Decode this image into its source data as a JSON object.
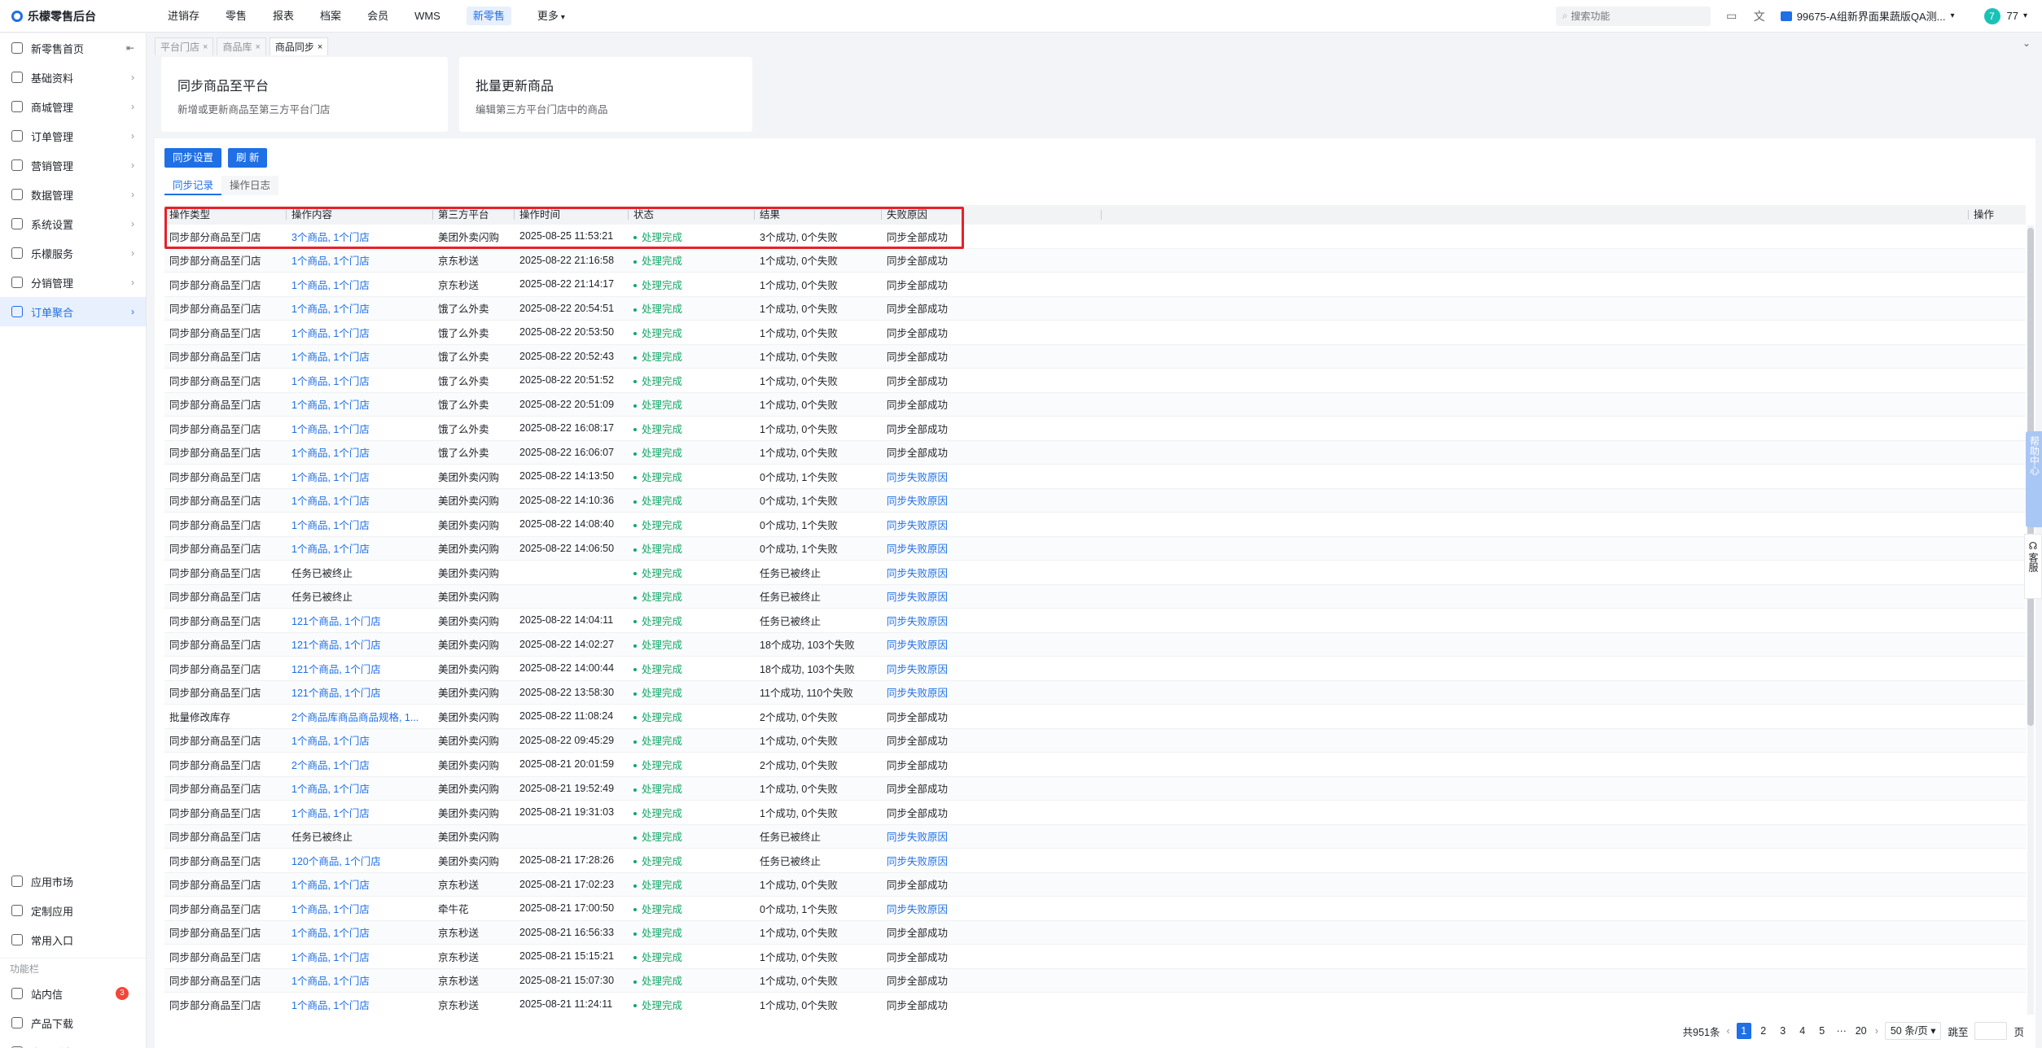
{
  "app": {
    "title": "乐檬零售后台"
  },
  "topnav": [
    {
      "label": "进销存",
      "active": false
    },
    {
      "label": "零售",
      "active": false
    },
    {
      "label": "报表",
      "active": false
    },
    {
      "label": "档案",
      "active": false
    },
    {
      "label": "会员",
      "active": false
    },
    {
      "label": "WMS",
      "active": false
    },
    {
      "label": "新零售",
      "active": true
    },
    {
      "label": "更多",
      "active": false
    }
  ],
  "search": {
    "placeholder": "搜索功能"
  },
  "store": {
    "name": "99675-A组新界面果蔬版QA测..."
  },
  "user": {
    "avatar": "7",
    "name": "77"
  },
  "sidebar": {
    "items": [
      {
        "label": "新零售首页"
      },
      {
        "label": "基础资料"
      },
      {
        "label": "商城管理"
      },
      {
        "label": "订单管理"
      },
      {
        "label": "营销管理"
      },
      {
        "label": "数据管理"
      },
      {
        "label": "系统设置"
      },
      {
        "label": "乐檬服务"
      },
      {
        "label": "分销管理"
      },
      {
        "label": "订单聚合"
      }
    ],
    "bottom": [
      {
        "label": "应用市场"
      },
      {
        "label": "定制应用"
      },
      {
        "label": "常用入口"
      }
    ],
    "section_title": "功能栏",
    "tools": [
      {
        "label": "站内信",
        "badge": "3"
      },
      {
        "label": "产品下载"
      },
      {
        "label": "文件列表"
      }
    ]
  },
  "tabs": [
    {
      "label": "平台门店"
    },
    {
      "label": "商品库"
    },
    {
      "label": "商品同步"
    }
  ],
  "cards": [
    {
      "title": "同步商品至平台",
      "desc": "新增或更新商品至第三方平台门店"
    },
    {
      "title": "批量更新商品",
      "desc": "编辑第三方平台门店中的商品"
    }
  ],
  "buttons": {
    "sync_settings": "同步设置",
    "refresh": "刷 新"
  },
  "subtabs": [
    {
      "label": "同步记录"
    },
    {
      "label": "操作日志"
    }
  ],
  "table": {
    "headers": [
      "操作类型",
      "操作内容",
      "第三方平台",
      "操作时间",
      "状态",
      "结果",
      "失败原因",
      "",
      "操作"
    ],
    "rows": [
      [
        "同步部分商品至门店",
        "3个商品, 1个门店",
        "美团外卖闪购",
        "2025-08-25 11:53:21",
        "处理完成",
        "3个成功, 0个失败",
        "同步全部成功"
      ],
      [
        "同步部分商品至门店",
        "1个商品, 1个门店",
        "京东秒送",
        "2025-08-22 21:16:58",
        "处理完成",
        "1个成功, 0个失败",
        "同步全部成功"
      ],
      [
        "同步部分商品至门店",
        "1个商品, 1个门店",
        "京东秒送",
        "2025-08-22 21:14:17",
        "处理完成",
        "1个成功, 0个失败",
        "同步全部成功"
      ],
      [
        "同步部分商品至门店",
        "1个商品, 1个门店",
        "饿了么外卖",
        "2025-08-22 20:54:51",
        "处理完成",
        "1个成功, 0个失败",
        "同步全部成功"
      ],
      [
        "同步部分商品至门店",
        "1个商品, 1个门店",
        "饿了么外卖",
        "2025-08-22 20:53:50",
        "处理完成",
        "1个成功, 0个失败",
        "同步全部成功"
      ],
      [
        "同步部分商品至门店",
        "1个商品, 1个门店",
        "饿了么外卖",
        "2025-08-22 20:52:43",
        "处理完成",
        "1个成功, 0个失败",
        "同步全部成功"
      ],
      [
        "同步部分商品至门店",
        "1个商品, 1个门店",
        "饿了么外卖",
        "2025-08-22 20:51:52",
        "处理完成",
        "1个成功, 0个失败",
        "同步全部成功"
      ],
      [
        "同步部分商品至门店",
        "1个商品, 1个门店",
        "饿了么外卖",
        "2025-08-22 20:51:09",
        "处理完成",
        "1个成功, 0个失败",
        "同步全部成功"
      ],
      [
        "同步部分商品至门店",
        "1个商品, 1个门店",
        "饿了么外卖",
        "2025-08-22 16:08:17",
        "处理完成",
        "1个成功, 0个失败",
        "同步全部成功"
      ],
      [
        "同步部分商品至门店",
        "1个商品, 1个门店",
        "饿了么外卖",
        "2025-08-22 16:06:07",
        "处理完成",
        "1个成功, 0个失败",
        "同步全部成功"
      ],
      [
        "同步部分商品至门店",
        "1个商品, 1个门店",
        "美团外卖闪购",
        "2025-08-22 14:13:50",
        "处理完成",
        "0个成功, 1个失败",
        "同步失败原因"
      ],
      [
        "同步部分商品至门店",
        "1个商品, 1个门店",
        "美团外卖闪购",
        "2025-08-22 14:10:36",
        "处理完成",
        "0个成功, 1个失败",
        "同步失败原因"
      ],
      [
        "同步部分商品至门店",
        "1个商品, 1个门店",
        "美团外卖闪购",
        "2025-08-22 14:08:40",
        "处理完成",
        "0个成功, 1个失败",
        "同步失败原因"
      ],
      [
        "同步部分商品至门店",
        "1个商品, 1个门店",
        "美团外卖闪购",
        "2025-08-22 14:06:50",
        "处理完成",
        "0个成功, 1个失败",
        "同步失败原因"
      ],
      [
        "同步部分商品至门店",
        "任务已被终止",
        "美团外卖闪购",
        "",
        "处理完成",
        "任务已被终止",
        "同步失败原因"
      ],
      [
        "同步部分商品至门店",
        "任务已被终止",
        "美团外卖闪购",
        "",
        "处理完成",
        "任务已被终止",
        "同步失败原因"
      ],
      [
        "同步部分商品至门店",
        "121个商品, 1个门店",
        "美团外卖闪购",
        "2025-08-22 14:04:11",
        "处理完成",
        "任务已被终止",
        "同步失败原因"
      ],
      [
        "同步部分商品至门店",
        "121个商品, 1个门店",
        "美团外卖闪购",
        "2025-08-22 14:02:27",
        "处理完成",
        "18个成功, 103个失败",
        "同步失败原因"
      ],
      [
        "同步部分商品至门店",
        "121个商品, 1个门店",
        "美团外卖闪购",
        "2025-08-22 14:00:44",
        "处理完成",
        "18个成功, 103个失败",
        "同步失败原因"
      ],
      [
        "同步部分商品至门店",
        "121个商品, 1个门店",
        "美团外卖闪购",
        "2025-08-22 13:58:30",
        "处理完成",
        "11个成功, 110个失败",
        "同步失败原因"
      ],
      [
        "批量修改库存",
        "2个商品库商品商品规格, 1...",
        "美团外卖闪购",
        "2025-08-22 11:08:24",
        "处理完成",
        "2个成功, 0个失败",
        "同步全部成功"
      ],
      [
        "同步部分商品至门店",
        "1个商品, 1个门店",
        "美团外卖闪购",
        "2025-08-22 09:45:29",
        "处理完成",
        "1个成功, 0个失败",
        "同步全部成功"
      ],
      [
        "同步部分商品至门店",
        "2个商品, 1个门店",
        "美团外卖闪购",
        "2025-08-21 20:01:59",
        "处理完成",
        "2个成功, 0个失败",
        "同步全部成功"
      ],
      [
        "同步部分商品至门店",
        "1个商品, 1个门店",
        "美团外卖闪购",
        "2025-08-21 19:52:49",
        "处理完成",
        "1个成功, 0个失败",
        "同步全部成功"
      ],
      [
        "同步部分商品至门店",
        "1个商品, 1个门店",
        "美团外卖闪购",
        "2025-08-21 19:31:03",
        "处理完成",
        "1个成功, 0个失败",
        "同步全部成功"
      ],
      [
        "同步部分商品至门店",
        "任务已被终止",
        "美团外卖闪购",
        "",
        "处理完成",
        "任务已被终止",
        "同步失败原因"
      ],
      [
        "同步部分商品至门店",
        "120个商品, 1个门店",
        "美团外卖闪购",
        "2025-08-21 17:28:26",
        "处理完成",
        "任务已被终止",
        "同步失败原因"
      ],
      [
        "同步部分商品至门店",
        "1个商品, 1个门店",
        "京东秒送",
        "2025-08-21 17:02:23",
        "处理完成",
        "1个成功, 0个失败",
        "同步全部成功"
      ],
      [
        "同步部分商品至门店",
        "1个商品, 1个门店",
        "牵牛花",
        "2025-08-21 17:00:50",
        "处理完成",
        "0个成功, 1个失败",
        "同步失败原因"
      ],
      [
        "同步部分商品至门店",
        "1个商品, 1个门店",
        "京东秒送",
        "2025-08-21 16:56:33",
        "处理完成",
        "1个成功, 0个失败",
        "同步全部成功"
      ],
      [
        "同步部分商品至门店",
        "1个商品, 1个门店",
        "京东秒送",
        "2025-08-21 15:15:21",
        "处理完成",
        "1个成功, 0个失败",
        "同步全部成功"
      ],
      [
        "同步部分商品至门店",
        "1个商品, 1个门店",
        "京东秒送",
        "2025-08-21 15:07:30",
        "处理完成",
        "1个成功, 0个失败",
        "同步全部成功"
      ],
      [
        "同步部分商品至门店",
        "1个商品, 1个门店",
        "京东秒送",
        "2025-08-21 11:24:11",
        "处理完成",
        "1个成功, 0个失败",
        "同步全部成功"
      ]
    ]
  },
  "pagination": {
    "total": "共951条",
    "pages": [
      "1",
      "2",
      "3",
      "4",
      "5",
      "···",
      "20"
    ],
    "page_size": "50 条/页",
    "jump_label": "跳至",
    "page_unit": "页"
  },
  "float": {
    "help": "帮助中心",
    "service": "客服"
  },
  "colors": {
    "accent": "#1f6fe5",
    "success": "#13a866",
    "highlight": "#e8202a"
  }
}
